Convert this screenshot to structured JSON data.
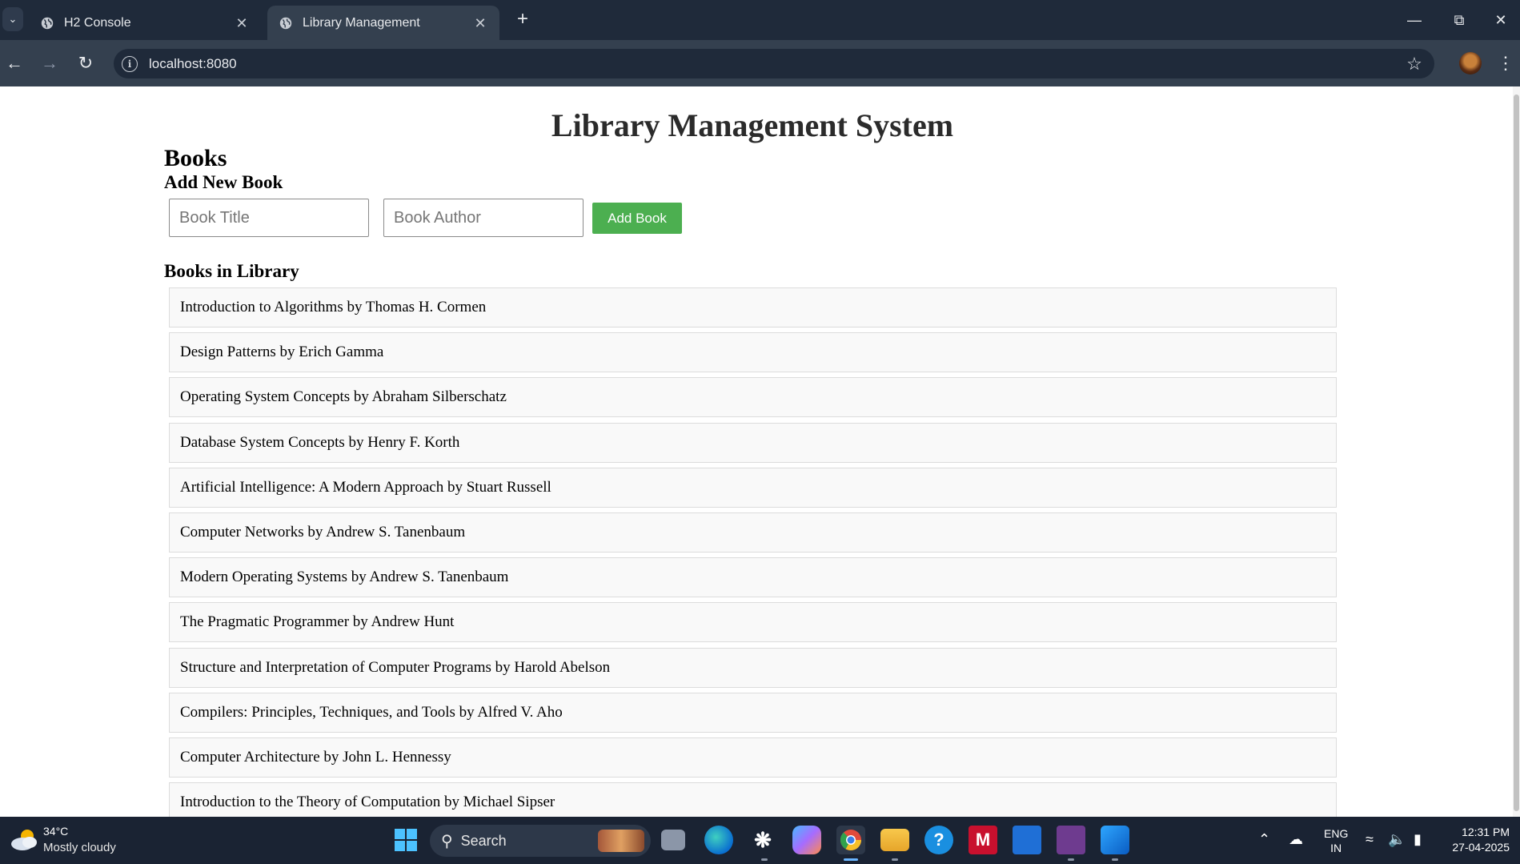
{
  "browser": {
    "tabs": [
      {
        "title": "H2 Console",
        "active": false
      },
      {
        "title": "Library Management",
        "active": true
      }
    ],
    "url": "localhost:8080"
  },
  "page": {
    "title": "Library Management System",
    "section_title": "Books",
    "form": {
      "heading": "Add New Book",
      "title_placeholder": "Book Title",
      "author_placeholder": "Book Author",
      "submit_label": "Add Book"
    },
    "list_heading": "Books in Library",
    "books": [
      "Introduction to Algorithms by Thomas H. Cormen",
      "Design Patterns by Erich Gamma",
      "Operating System Concepts by Abraham Silberschatz",
      "Database System Concepts by Henry F. Korth",
      "Artificial Intelligence: A Modern Approach by Stuart Russell",
      "Computer Networks by Andrew S. Tanenbaum",
      "Modern Operating Systems by Andrew S. Tanenbaum",
      "The Pragmatic Programmer by Andrew Hunt",
      "Structure and Interpretation of Computer Programs by Harold Abelson",
      "Compilers: Principles, Techniques, and Tools by Alfred V. Aho",
      "Computer Architecture by John L. Hennessy",
      "Introduction to the Theory of Computation by Michael Sipser"
    ]
  },
  "taskbar": {
    "weather_temp": "34°C",
    "weather_desc": "Mostly cloudy",
    "search_label": "Search",
    "lang_line1": "ENG",
    "lang_line2": "IN",
    "time": "12:31 PM",
    "date": "27-04-2025"
  },
  "colors": {
    "add_button": "#4caf50",
    "chrome_dark": "#1f2a3a",
    "chrome_toolbar": "#34404f",
    "taskbar": "#1a2333"
  }
}
